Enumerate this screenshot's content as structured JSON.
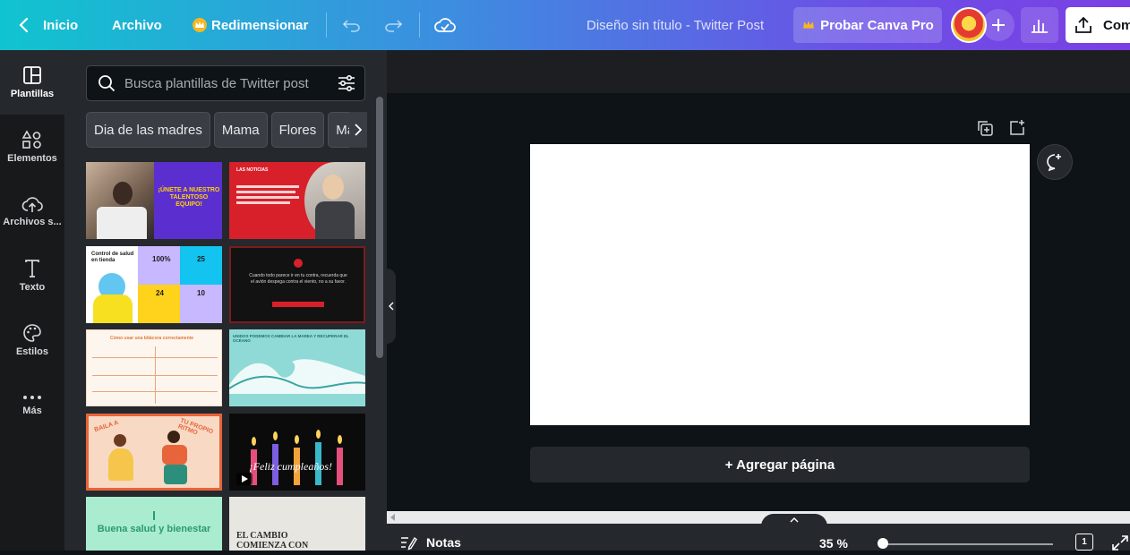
{
  "topbar": {
    "home_label": "Inicio",
    "file_label": "Archivo",
    "resize_label": "Redimensionar",
    "doc_title": "Diseño sin título - Twitter Post",
    "pro_label": "Probar Canva Pro",
    "share_label": "Com"
  },
  "rail": {
    "items": [
      {
        "label": "Plantillas"
      },
      {
        "label": "Elementos"
      },
      {
        "label": "Archivos s..."
      },
      {
        "label": "Texto"
      },
      {
        "label": "Estilos"
      },
      {
        "label": "Más"
      }
    ]
  },
  "panel": {
    "search_placeholder": "Busca plantillas de Twitter post",
    "chips": [
      "Dia de las madres",
      "Mama",
      "Flores",
      "Mar"
    ],
    "templates": [
      {
        "text": "¡ÚNETE A NUESTRO TALENTOSO EQUIPO!",
        "bg": "#5b2fcf"
      },
      {
        "text": "LAS NOTICIAS",
        "bg": "#d8202a"
      },
      {
        "text": "Control de salud en tienda",
        "bg": "#ffffff"
      },
      {
        "text": "Cuando todo parece ir en tu contra, recuerda que el avión despega contra el viento, no a su favor.",
        "bg": "#121212"
      },
      {
        "text": "Cómo usar una bitácora correctamente",
        "bg": "#fdf6ee"
      },
      {
        "text": "UNIDOS PODEMOS CAMBIAR LA MAREA Y RECUPERAR EL OCÉANO",
        "bg": "#8fdad6"
      },
      {
        "text": "BAILA A TU PROPIO RITMO",
        "bg": "#f7d9c4"
      },
      {
        "text": "¡Feliz cumpleaños!",
        "bg": "#0b0b0b"
      },
      {
        "text": "Buena salud y bienestar",
        "bg": "#a9ecd0"
      },
      {
        "text": "EL CAMBIO COMIENZA CON",
        "bg": "#e8e6e1"
      }
    ],
    "stats": [
      "100%",
      "25",
      "24",
      "10"
    ]
  },
  "canvas": {
    "add_page_label": "+ Agregar página"
  },
  "bottombar": {
    "notes_label": "Notas",
    "zoom_label": "35 %",
    "page_count": "1"
  }
}
